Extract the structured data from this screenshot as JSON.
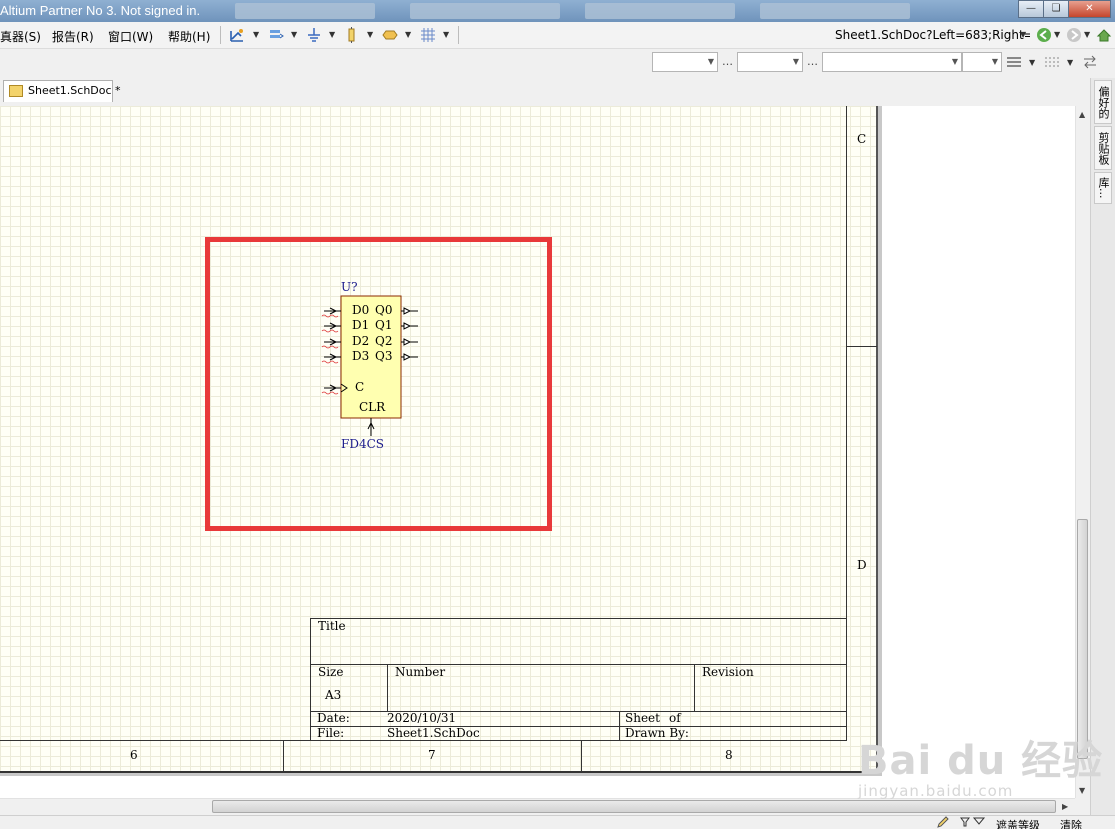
{
  "window": {
    "title": "Altium Partner No 3. Not signed in."
  },
  "menu": [
    {
      "label": "真器(S)"
    },
    {
      "label": "报告(R)"
    },
    {
      "label": "窗口(W)"
    },
    {
      "label": "帮助(H)"
    }
  ],
  "toolbar": {
    "icons": [
      "wire-tool-icon",
      "bus-tool-icon",
      "power-port-icon",
      "component-icon",
      "net-label-icon",
      "grid-icon"
    ],
    "address": "Sheet1.SchDoc?Left=683;Right="
  },
  "tabs": {
    "active_label": "Sheet1.SchDoc *"
  },
  "side_panels": [
    {
      "label": "偏好的"
    },
    {
      "label": "剪贴板"
    },
    {
      "label": "库..."
    }
  ],
  "sheet": {
    "zone_rows": [
      "C",
      "D"
    ],
    "zone_columns": [
      "6",
      "7",
      "8"
    ]
  },
  "component": {
    "designator": "U?",
    "comment": "FD4CS",
    "left_pins": [
      "D0",
      "D1",
      "D2",
      "D3"
    ],
    "right_pins": [
      "Q0",
      "Q1",
      "Q2",
      "Q3"
    ],
    "clock_pin": "C",
    "clear_pin": "CLR",
    "fill_color": "#ffffb0",
    "border_color": "#8b2a00",
    "text_color": "#1a1a8b"
  },
  "title_block": {
    "title_label": "Title",
    "size_label": "Size",
    "size_value": "A3",
    "number_label": "Number",
    "revision_label": "Revision",
    "date_label": "Date:",
    "date_value": "2020/10/31",
    "file_label": "File:",
    "file_value": "Sheet1.SchDoc",
    "sheet_label": "Sheet",
    "of_label": "of",
    "drawn_by_label": "Drawn By:"
  },
  "status": {
    "mask_label": "遮盖等级",
    "clear_label": "清除"
  },
  "highlight_color": "#e8393a",
  "watermark": {
    "main": "Bai du 经验",
    "sub": "jingyan.baidu.com"
  }
}
